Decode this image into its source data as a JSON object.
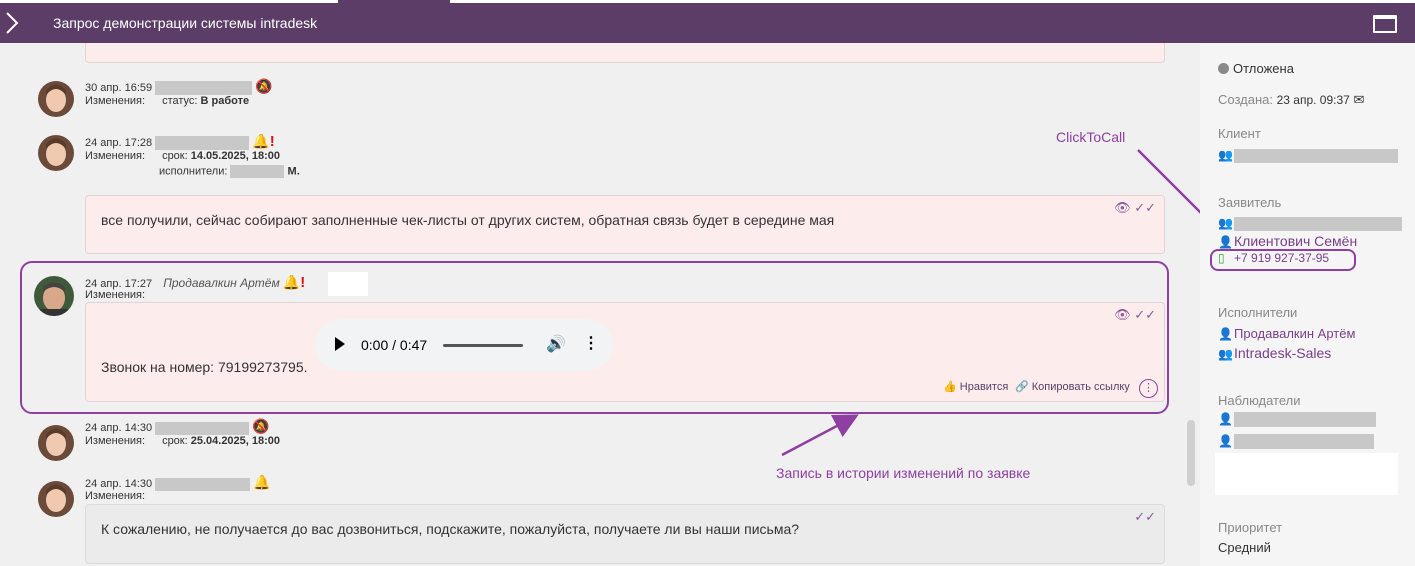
{
  "header": {
    "title": "Запрос демонстрации системы intradesk"
  },
  "history": [
    {
      "time": "30 апр. 16:59",
      "changes_label": "Изменения:",
      "change1": "статус:",
      "change1_value": "В работе"
    },
    {
      "time": "24 апр. 17:28",
      "changes_label": "Изменения:",
      "change1": "срок:",
      "change1_value": "14.05.2025, 18:00",
      "change2": "исполнители:",
      "change2_suffix": "М."
    },
    {
      "time": "24 апр. 17:27",
      "author": "Продавалкин Артём",
      "changes_label": "Изменения:"
    },
    {
      "time": "24 апр. 14:30",
      "changes_label": "Изменения:",
      "change1": "срок:",
      "change1_value": "25.04.2025, 18:00"
    },
    {
      "time": "24 апр. 14:30",
      "changes_label": "Изменения:"
    }
  ],
  "comments": {
    "first": "все получили, сейчас собирают заполненные чек-листы от других систем, обратная связь будет в середине мая",
    "call": "Звонок на номер: 79199273795.",
    "last": "К сожалению, не получается до вас дозвониться, подскажите, пожалуйста, получаете ли вы наши письма?"
  },
  "audio": {
    "time": "0:00 / 0:47"
  },
  "actions": {
    "like": "Нравится",
    "copy": "Копировать ссылку"
  },
  "annotations": {
    "clicktocall": "ClickToCall",
    "history_note": "Запись в истории изменений по заявке"
  },
  "sidebar": {
    "status": "Отложена",
    "created_label": "Создана:",
    "created_value": "23 апр. 09:37",
    "client_label": "Клиент",
    "requester_label": "Заявитель",
    "requester_name": "Клиентович Семён",
    "phone": "+7 919 927-37-95",
    "assignees_label": "Исполнители",
    "assignee1": "Продавалкин Артём",
    "assignee2": "Intradesk-Sales",
    "watchers_label": "Наблюдатели",
    "priority_label": "Приоритет",
    "priority_value": "Средний"
  },
  "colors": {
    "header": "#5b3d68",
    "accent": "#8e3fa1",
    "priority": "#e8a317",
    "card_pink": "#fdecec"
  }
}
